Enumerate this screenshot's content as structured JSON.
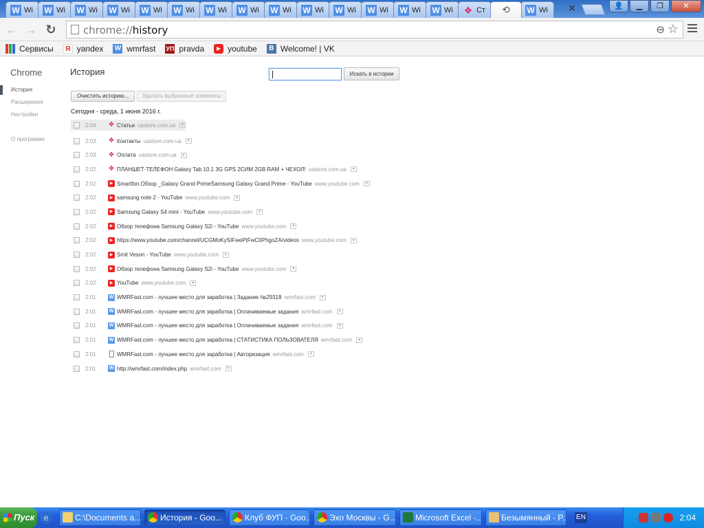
{
  "tabs": [
    {
      "title": "WMRFast",
      "icon": "w-icon"
    },
    {
      "title": "WMRFast",
      "icon": "w-icon"
    },
    {
      "title": "WMRFast",
      "icon": "w-icon"
    },
    {
      "title": "WMRFast",
      "icon": "w-icon"
    },
    {
      "title": "WMRFast",
      "icon": "w-icon"
    },
    {
      "title": "WMRFast",
      "icon": "w-icon"
    },
    {
      "title": "WMRFast",
      "icon": "w-icon"
    },
    {
      "title": "WMRFast",
      "icon": "w-icon"
    },
    {
      "title": "WMRFast",
      "icon": "w-icon"
    },
    {
      "title": "WMRFast",
      "icon": "w-icon"
    },
    {
      "title": "WMRFast",
      "icon": "w-icon"
    },
    {
      "title": "WMRFast",
      "icon": "w-icon"
    },
    {
      "title": "WMRFast",
      "icon": "w-icon"
    },
    {
      "title": "WMRFast",
      "icon": "w-icon"
    },
    {
      "title": "Ст",
      "icon": "uastore-icon"
    },
    {
      "title": "WMRFast",
      "icon": "w-icon"
    }
  ],
  "tab_short": "W",
  "tab_frag": "Wi",
  "active_tab_icon": "history-icon",
  "omnibox": {
    "scheme": "chrome://",
    "host": "history"
  },
  "bookmarks": [
    {
      "label": "Сервисы",
      "icon": "apps-icon",
      "glyph": ""
    },
    {
      "label": "yandex",
      "icon": "yandex-icon",
      "glyph": "Я"
    },
    {
      "label": "wmrfast",
      "icon": "w-icon",
      "glyph": "W"
    },
    {
      "label": "pravda",
      "icon": "up-icon",
      "glyph": "УП"
    },
    {
      "label": "youtube",
      "icon": "youtube-icon",
      "glyph": "▶"
    },
    {
      "label": "Welcome! | VK",
      "icon": "vk-icon",
      "glyph": "B"
    }
  ],
  "sidebar": {
    "brand": "Chrome",
    "items": [
      "История",
      "Расширения",
      "Настройки"
    ],
    "about": "О программе"
  },
  "history": {
    "title": "История",
    "search_button": "Искать в истории",
    "clear_button": "Очистить историю...",
    "remove_button": "Удалить выбранные элементы",
    "day_header": "Сегодня - среда, 1 июня 2016 г.",
    "entries": [
      {
        "time": "2:04",
        "site": "uastore",
        "title": "Статьи",
        "domain": "uastore.com.ua"
      },
      {
        "time": "2:03",
        "site": "uastore",
        "title": "Контакты",
        "domain": "uastore.com.ua"
      },
      {
        "time": "2:03",
        "site": "uastore",
        "title": "Оплата",
        "domain": "uastore.com.ua"
      },
      {
        "time": "2:02",
        "site": "uastore",
        "title": "ПЛАНШЕТ-ТЕЛЕФОН Galaxy Tab 10.1 3G GPS 2СИМ 2GB RAM + ЧЕХОЛ!",
        "domain": "uastore.com.ua"
      },
      {
        "time": "2:02",
        "site": "youtube",
        "title": "Smartfon.Обзор _Galaxy Grand PrimeSamsung Galaxy Grand Prime - YouTube",
        "domain": "www.youtube.com"
      },
      {
        "time": "2:02",
        "site": "youtube",
        "title": "samsung note 2 - YouTube",
        "domain": "www.youtube.com"
      },
      {
        "time": "2:02",
        "site": "youtube",
        "title": "Samsung Galaxy S4 mini - YouTube",
        "domain": "www.youtube.com"
      },
      {
        "time": "2:02",
        "site": "youtube",
        "title": "Обзор телефона Samsung Galaxy S2i - YouTube",
        "domain": "www.youtube.com"
      },
      {
        "time": "2:02",
        "site": "youtube",
        "title": "https://www.youtube.com/channel/UCGMoKySIFwePtFwC0PhgoZA/videos",
        "domain": "www.youtube.com"
      },
      {
        "time": "2:02",
        "site": "youtube",
        "title": "Smit Veson - YouTube",
        "domain": "www.youtube.com"
      },
      {
        "time": "2:02",
        "site": "youtube",
        "title": "Обзор телефона Samsung Galaxy S2i - YouTube",
        "domain": "www.youtube.com"
      },
      {
        "time": "2:02",
        "site": "youtube",
        "title": "YouTube",
        "domain": "www.youtube.com"
      },
      {
        "time": "2:01",
        "site": "wmr",
        "title": "WMRFast.com - лучшее место для заработка | Задание №29318",
        "domain": "wmrfast.com"
      },
      {
        "time": "2:01",
        "site": "wmr",
        "title": "WMRFast.com - лучшее место для заработка | Оплачиваемые задания",
        "domain": "wmrfast.com"
      },
      {
        "time": "2:01",
        "site": "wmr",
        "title": "WMRFast.com - лучшее место для заработка | Оплачиваемые задания",
        "domain": "wmrfast.com"
      },
      {
        "time": "2:01",
        "site": "wmr",
        "title": "WMRFast.com - лучшее место для заработка | СТАТИСТИКА ПОЛЬЗОВАТЕЛЯ",
        "domain": "wmrfast.com"
      },
      {
        "time": "2:01",
        "site": "page",
        "title": "WMRFast.com - лучшее место для заработка | Авторизация",
        "domain": "wmrfast.com"
      },
      {
        "time": "2:01",
        "site": "wmr",
        "title": "http://wmrfast.com/index.php",
        "domain": "wmrfast.com"
      }
    ]
  },
  "taskbar": {
    "start": "Пуск",
    "tasks": [
      {
        "label": "C:\\Documents a...",
        "icon": "folder"
      },
      {
        "label": "История - Goo...",
        "icon": "chrome",
        "active": true
      },
      {
        "label": "Клуб ФУП - Goo...",
        "icon": "chrome"
      },
      {
        "label": "Эхо Москвы - G...",
        "icon": "chrome"
      },
      {
        "label": "Microsoft Excel -...",
        "icon": "excel"
      },
      {
        "label": "Безымянный - P...",
        "icon": "paint"
      }
    ],
    "lang": "EN",
    "clock": "2:04"
  }
}
